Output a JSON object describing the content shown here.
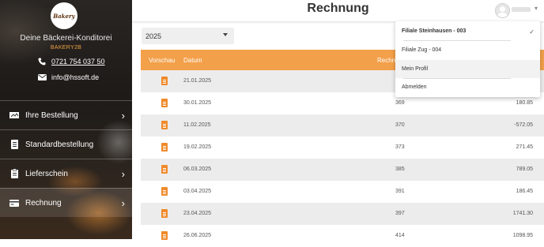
{
  "sidebar": {
    "logo_text": "Bakery",
    "company": "Deine Bäckerei-Konditorei",
    "code": "BAKERY2B",
    "phone": "0721 754 037 50",
    "email": "info@hssoft.de",
    "items": [
      {
        "label": "Ihre Bestellung",
        "icon": "cart-icon"
      },
      {
        "label": "Standardbestellung",
        "icon": "document-icon"
      },
      {
        "label": "Lieferschein",
        "icon": "clipboard-icon"
      },
      {
        "label": "Rechnung",
        "icon": "credit-card-icon"
      }
    ]
  },
  "header": {
    "title": "Rechnung"
  },
  "filter": {
    "year": "2025"
  },
  "table": {
    "columns": [
      "Vorschau",
      "Datum",
      "Rechn"
    ],
    "rows": [
      {
        "date": "21.01.2025",
        "number": "",
        "amount": ""
      },
      {
        "date": "30.01.2025",
        "number": "369",
        "amount": "180.85"
      },
      {
        "date": "11.02.2025",
        "number": "370",
        "amount": "-572.05"
      },
      {
        "date": "19.02.2025",
        "number": "373",
        "amount": "271.45"
      },
      {
        "date": "06.03.2025",
        "number": "385",
        "amount": "789.05"
      },
      {
        "date": "03.04.2025",
        "number": "391",
        "amount": "186.45"
      },
      {
        "date": "23.04.2025",
        "number": "397",
        "amount": "1741.30"
      },
      {
        "date": "26.06.2025",
        "number": "414",
        "amount": "1098.95"
      }
    ]
  },
  "dropdown": {
    "items": [
      "Filiale Steinhausen - 003",
      "Filiale Zug - 004",
      "Mein Profil",
      "Abmelden"
    ],
    "checkmark": "✓"
  }
}
